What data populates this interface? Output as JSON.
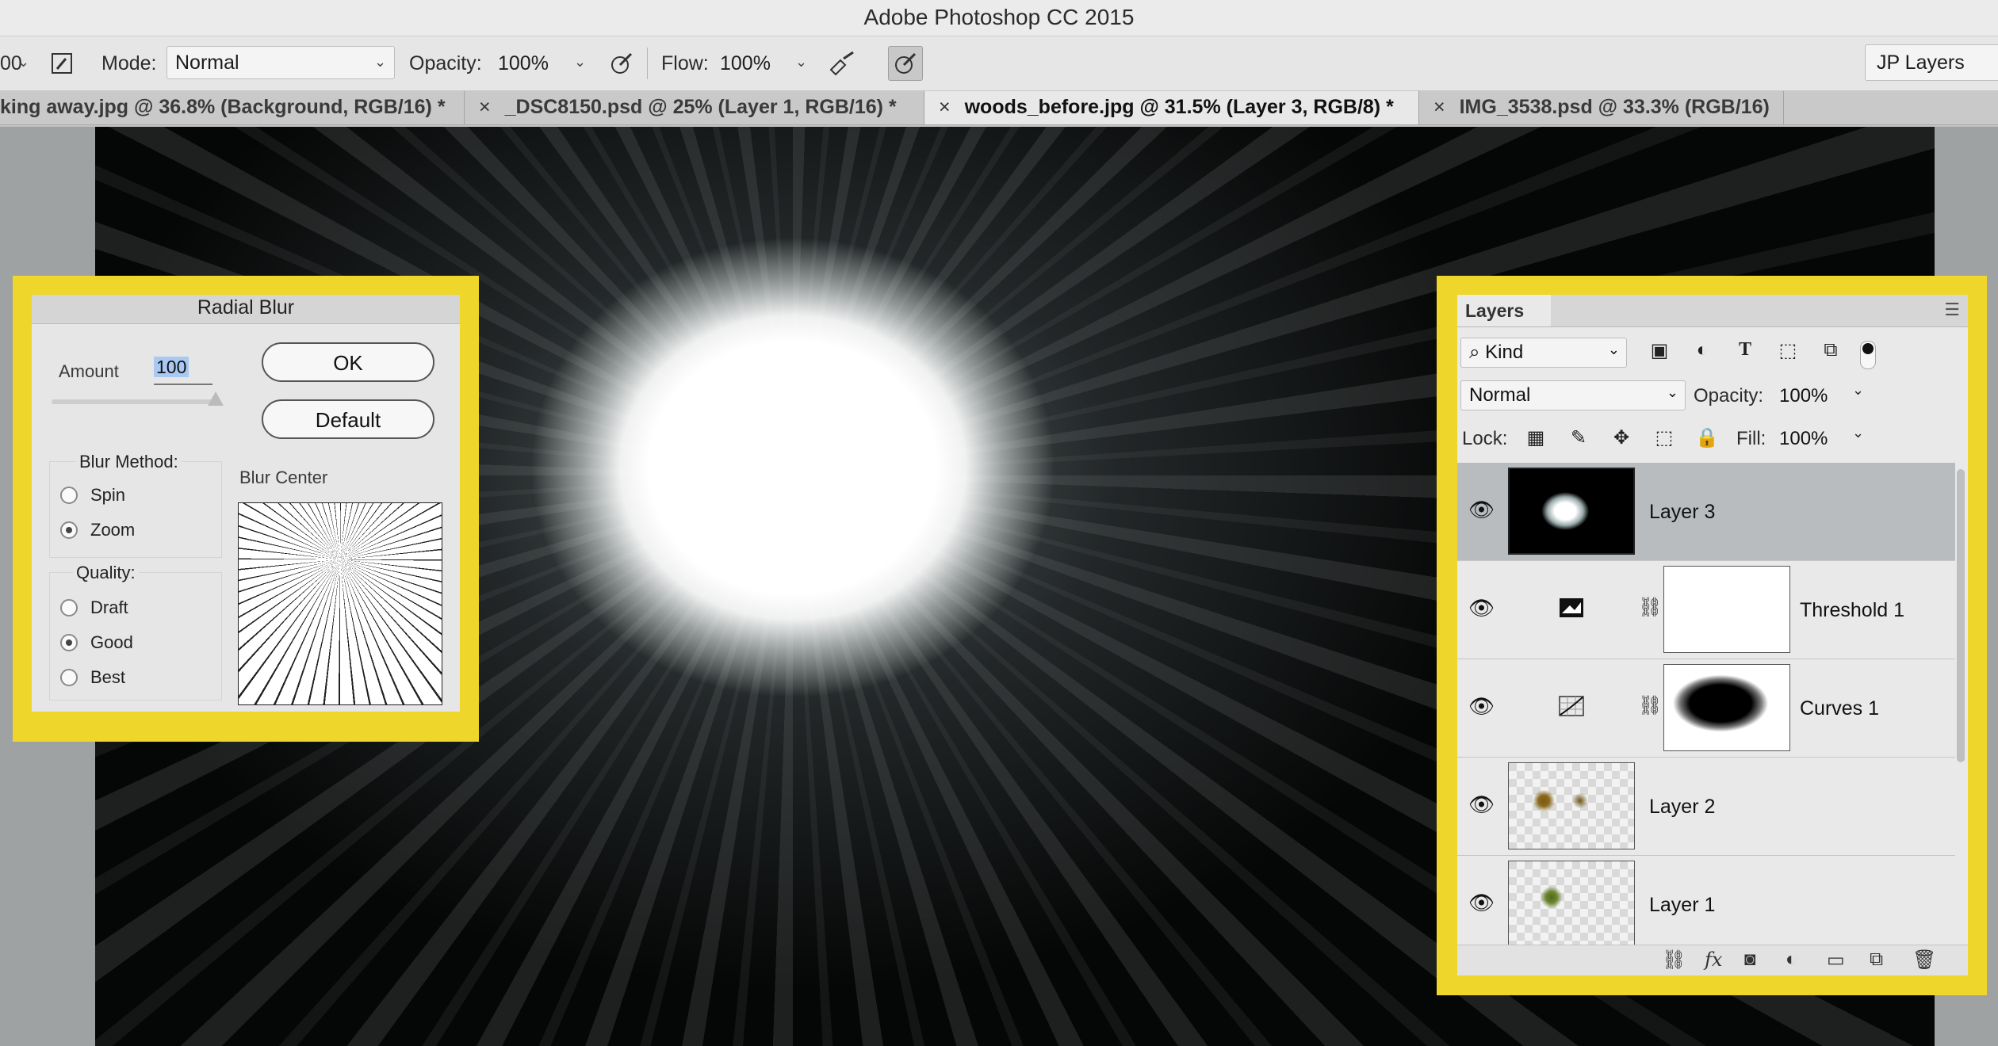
{
  "app": {
    "title": "Adobe Photoshop CC 2015"
  },
  "options_bar": {
    "brush_size_fragment": "00",
    "mode_label": "Mode:",
    "mode_value": "Normal",
    "opacity_label": "Opacity:",
    "opacity_value": "100%",
    "flow_label": "Flow:",
    "flow_value": "100%",
    "workspace": "JP Layers"
  },
  "tabs": [
    {
      "label": "king away.jpg @ 36.8% (Background, RGB/16) *",
      "close": ""
    },
    {
      "label": "_DSC8150.psd @ 25% (Layer 1, RGB/16) *",
      "close": "×"
    },
    {
      "label": "woods_before.jpg @ 31.5% (Layer 3, RGB/8) *",
      "close": "×",
      "active": true
    },
    {
      "label": "IMG_3538.psd @ 33.3% (RGB/16)",
      "close": "×"
    }
  ],
  "radial_blur": {
    "title": "Radial Blur",
    "amount_label": "Amount",
    "amount_value": "100",
    "ok": "OK",
    "default": "Default",
    "blur_method_label": "Blur Method:",
    "spin": "Spin",
    "zoom": "Zoom",
    "quality_label": "Quality:",
    "draft": "Draft",
    "good": "Good",
    "best": "Best",
    "blur_center_label": "Blur Center",
    "method_selected": "Zoom",
    "quality_selected": "Good"
  },
  "layers_panel": {
    "tab": "Layers",
    "kind": "Kind",
    "blend_mode": "Normal",
    "opacity_label": "Opacity:",
    "opacity_value": "100%",
    "lock_label": "Lock:",
    "fill_label": "Fill:",
    "fill_value": "100%",
    "layers": [
      {
        "name": "Layer 3",
        "selected": true
      },
      {
        "name": "Threshold 1"
      },
      {
        "name": "Curves 1"
      },
      {
        "name": "Layer 2"
      },
      {
        "name": "Layer 1"
      }
    ],
    "bottom_icons": [
      "link-icon",
      "fx-icon",
      "mask-icon",
      "adjustment-icon",
      "folder-icon",
      "new-layer-icon",
      "trash-icon"
    ]
  },
  "colors": {
    "highlight_frame": "#eed62a",
    "selected_layer": "#b9bcbe"
  }
}
